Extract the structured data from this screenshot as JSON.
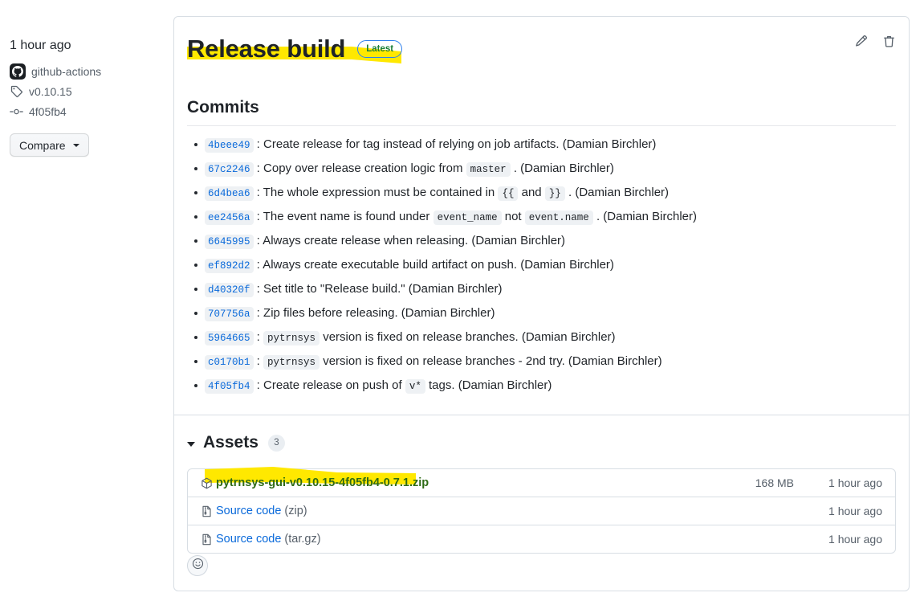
{
  "meta": {
    "published_time": "1 hour ago",
    "author": "github-actions",
    "author_icon": "github-avatar-icon",
    "tag": "v0.10.15",
    "tag_icon": "tag-icon",
    "commit_sha": "4f05fb4",
    "commit_icon": "commit-icon",
    "compare_label": "Compare",
    "compare_caret_icon": "chevron-down-icon"
  },
  "header": {
    "title": "Release build",
    "badge": "Latest",
    "badge_text_color": "#1a7f37",
    "badge_border_color": "#2f80ed",
    "edit_icon": "pencil-icon",
    "delete_icon": "trash-icon"
  },
  "commits": {
    "heading": "Commits",
    "items": [
      {
        "sha": "4beee49",
        "sep": ":",
        "parts": [
          {
            "t": "text",
            "v": "Create release for tag instead of relying on job artifacts. (Damian Birchler)"
          }
        ]
      },
      {
        "sha": "67c2246",
        "sep": ":",
        "parts": [
          {
            "t": "text",
            "v": "Copy over release creation logic from"
          },
          {
            "t": "code",
            "v": "master"
          },
          {
            "t": "text",
            "v": ". (Damian Birchler)"
          }
        ]
      },
      {
        "sha": "6d4bea6",
        "sep": ":",
        "parts": [
          {
            "t": "text",
            "v": "The whole expression must be contained in"
          },
          {
            "t": "code",
            "v": "{{"
          },
          {
            "t": "text",
            "v": "and"
          },
          {
            "t": "code",
            "v": "}}"
          },
          {
            "t": "text",
            "v": ". (Damian Birchler)"
          }
        ]
      },
      {
        "sha": "ee2456a",
        "sep": ":",
        "parts": [
          {
            "t": "text",
            "v": "The event name is found under"
          },
          {
            "t": "code",
            "v": "event_name"
          },
          {
            "t": "text",
            "v": "not"
          },
          {
            "t": "code",
            "v": "event.name"
          },
          {
            "t": "text",
            "v": ". (Damian Birchler)"
          }
        ]
      },
      {
        "sha": "6645995",
        "sep": ":",
        "parts": [
          {
            "t": "text",
            "v": "Always create release when releasing. (Damian Birchler)"
          }
        ]
      },
      {
        "sha": "ef892d2",
        "sep": ":",
        "parts": [
          {
            "t": "text",
            "v": "Always create executable build artifact on push. (Damian Birchler)"
          }
        ]
      },
      {
        "sha": "d40320f",
        "sep": ":",
        "parts": [
          {
            "t": "text",
            "v": "Set title to \"Release build.\" (Damian Birchler)"
          }
        ]
      },
      {
        "sha": "707756a",
        "sep": ":",
        "parts": [
          {
            "t": "text",
            "v": "Zip files before releasing. (Damian Birchler)"
          }
        ]
      },
      {
        "sha": "5964665",
        "sep": ":",
        "parts": [
          {
            "t": "code",
            "v": "pytrnsys"
          },
          {
            "t": "text",
            "v": "version is fixed on release branches. (Damian Birchler)"
          }
        ]
      },
      {
        "sha": "c0170b1",
        "sep": ":",
        "parts": [
          {
            "t": "code",
            "v": "pytrnsys"
          },
          {
            "t": "text",
            "v": "version is fixed on release branches - 2nd try. (Damian Birchler)"
          }
        ]
      },
      {
        "sha": "4f05fb4",
        "sep": ":",
        "parts": [
          {
            "t": "text",
            "v": "Create release on push of"
          },
          {
            "t": "code",
            "v": "v*"
          },
          {
            "t": "text",
            "v": "tags. (Damian Birchler)"
          }
        ]
      }
    ]
  },
  "assets": {
    "heading": "Assets",
    "count": "3",
    "collapse_icon": "triangle-down-icon",
    "rows": [
      {
        "icon": "package-icon",
        "name": "pytrnsys-gui-v0.10.15-4f05fb4-0.7.1.zip",
        "suffix": "",
        "size": "168 MB",
        "time": "1 hour ago",
        "highlighted": true
      },
      {
        "icon": "file-zip-icon",
        "name": "Source code",
        "suffix": "(zip)",
        "size": "",
        "time": "1 hour ago",
        "highlighted": false
      },
      {
        "icon": "file-zip-icon",
        "name": "Source code",
        "suffix": "(tar.gz)",
        "size": "",
        "time": "1 hour ago",
        "highlighted": false
      }
    ]
  },
  "reaction": {
    "icon": "smiley-icon"
  },
  "annotations": {
    "highlighter_color": "#FFE800",
    "marks": [
      {
        "name": "title-highlight",
        "target": "Release build / Latest"
      },
      {
        "name": "asset-highlight",
        "target": "pytrnsys-gui-v0.10.15-4f05fb4-0.7.1.zip"
      }
    ]
  }
}
